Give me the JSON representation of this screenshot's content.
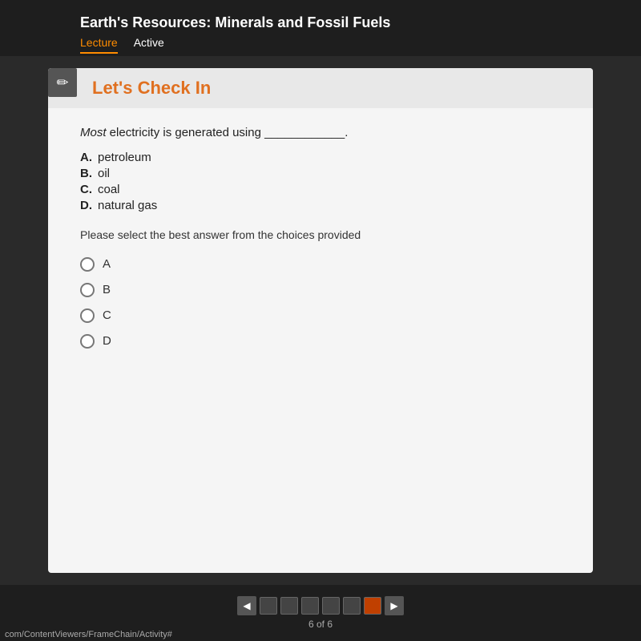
{
  "header": {
    "course_title": "Earth's Resources: Minerals and Fossil Fuels",
    "tabs": [
      {
        "id": "lecture",
        "label": "Lecture",
        "active": true
      },
      {
        "id": "active",
        "label": "Active",
        "active": false
      }
    ]
  },
  "section": {
    "title": "Let's Check In",
    "pencil_icon": "✏"
  },
  "question": {
    "text_prefix": "Most electricity is generated using",
    "blank": "____________",
    "text_suffix": ".",
    "choices": [
      {
        "letter": "A.",
        "text": "petroleum"
      },
      {
        "letter": "B.",
        "text": "oil"
      },
      {
        "letter": "C.",
        "text": "coal"
      },
      {
        "letter": "D.",
        "text": "natural gas"
      }
    ]
  },
  "instruction": "Please select the best answer from the choices provided",
  "radio_options": [
    {
      "id": "A",
      "label": "A"
    },
    {
      "id": "B",
      "label": "B"
    },
    {
      "id": "C",
      "label": "C"
    },
    {
      "id": "D",
      "label": "D"
    }
  ],
  "pagination": {
    "current": 6,
    "total": 6,
    "label": "6 of 6",
    "dots": [
      1,
      2,
      3,
      4,
      5,
      6
    ]
  },
  "url": "com/ContentViewers/FrameChain/Activity#"
}
